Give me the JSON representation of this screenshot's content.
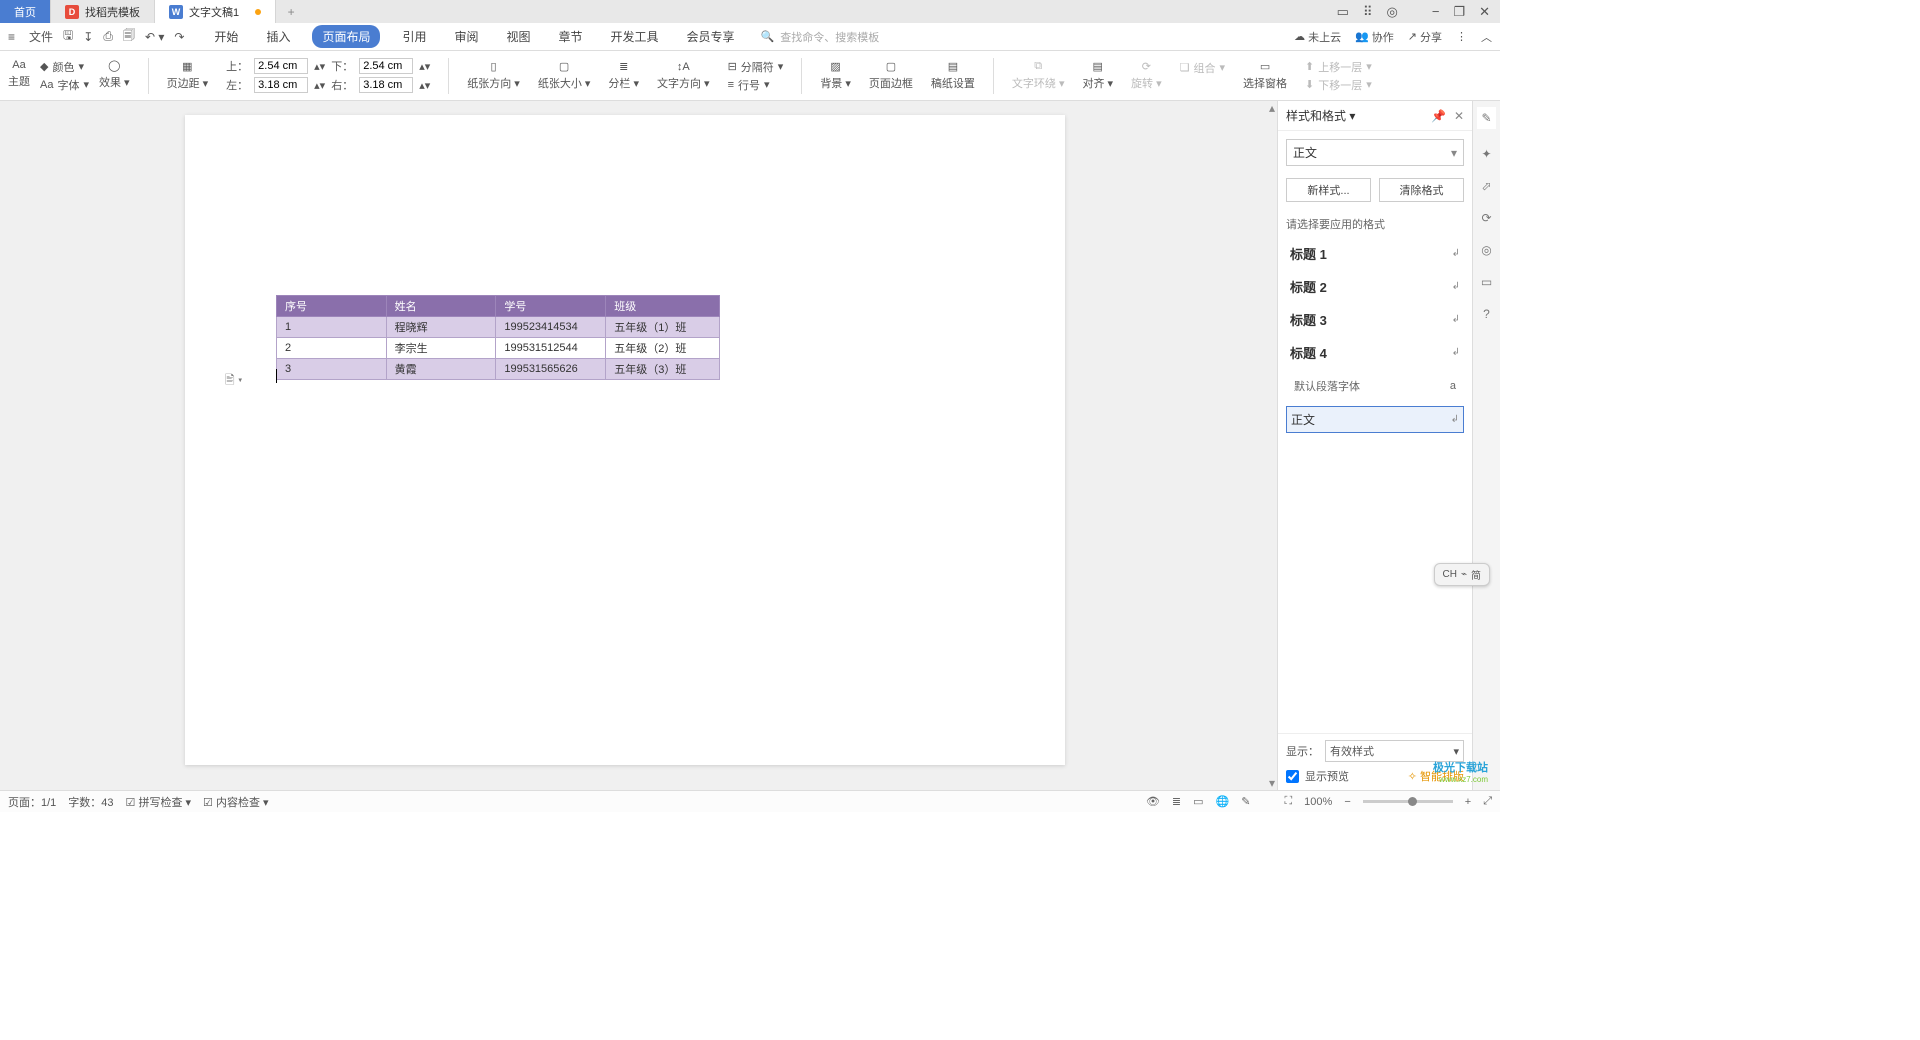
{
  "tabs": {
    "home": "首页",
    "template": "找稻壳模板",
    "doc": "文字文稿1"
  },
  "window_controls": {
    "min": "−",
    "restore": "❐",
    "close": "✕"
  },
  "menu": {
    "file": "文件",
    "items": [
      "开始",
      "插入",
      "页面布局",
      "引用",
      "审阅",
      "视图",
      "章节",
      "开发工具",
      "会员专享"
    ],
    "active_index": 2,
    "search_placeholder": "查找命令、搜索模板",
    "right": {
      "cloud": "未上云",
      "collab": "协作",
      "share": "分享"
    }
  },
  "ribbon": {
    "theme": "主题",
    "font": "字体",
    "color": "颜色",
    "effect": "效果",
    "margin_label": "页边距",
    "margins": {
      "top": "2.54 cm",
      "bottom": "2.54 cm",
      "left": "3.18 cm",
      "right": "3.18 cm",
      "top_sym": "上：",
      "bottom_sym": "下：",
      "left_sym": "左：",
      "right_sym": "右："
    },
    "orientation": "纸张方向",
    "size": "纸张大小",
    "columns": "分栏",
    "textdir": "文字方向",
    "separator": "分隔符",
    "lineno": "行号",
    "background": "背景",
    "border": "页面边框",
    "paperset": "稿纸设置",
    "textwrap": "文字环绕",
    "align": "对齐",
    "rotate": "旋转",
    "selpane": "选择窗格",
    "group": "组合",
    "forward": "上移一层",
    "backward": "下移一层"
  },
  "table": {
    "headers": [
      "序号",
      "姓名",
      "学号",
      "班级"
    ],
    "rows": [
      [
        "1",
        "程晓辉",
        "199523414534",
        "五年级（1）班"
      ],
      [
        "2",
        "李宗生",
        "199531512544",
        "五年级（2）班"
      ],
      [
        "3",
        "黄霞",
        "199531565626",
        "五年级（3）班"
      ]
    ]
  },
  "right_pane": {
    "title": "样式和格式",
    "current_style": "正文",
    "new_style": "新样式...",
    "clear": "清除格式",
    "hint": "请选择要应用的格式",
    "styles": [
      "标题 1",
      "标题 2",
      "标题 3",
      "标题 4"
    ],
    "default_font": "默认段落字体",
    "normal": "正文",
    "show_label": "显示：",
    "show_value": "有效样式",
    "preview": "显示预览",
    "smart": "智能排版"
  },
  "ime": {
    "lang": "CH",
    "mode": "简"
  },
  "status": {
    "page": "页面：1/1",
    "words": "字数：43",
    "spell": "拼写检查",
    "content": "内容检查",
    "zoom": "100%"
  },
  "watermark": {
    "l1": "极光下载站",
    "l2": "www.xz7.com"
  }
}
